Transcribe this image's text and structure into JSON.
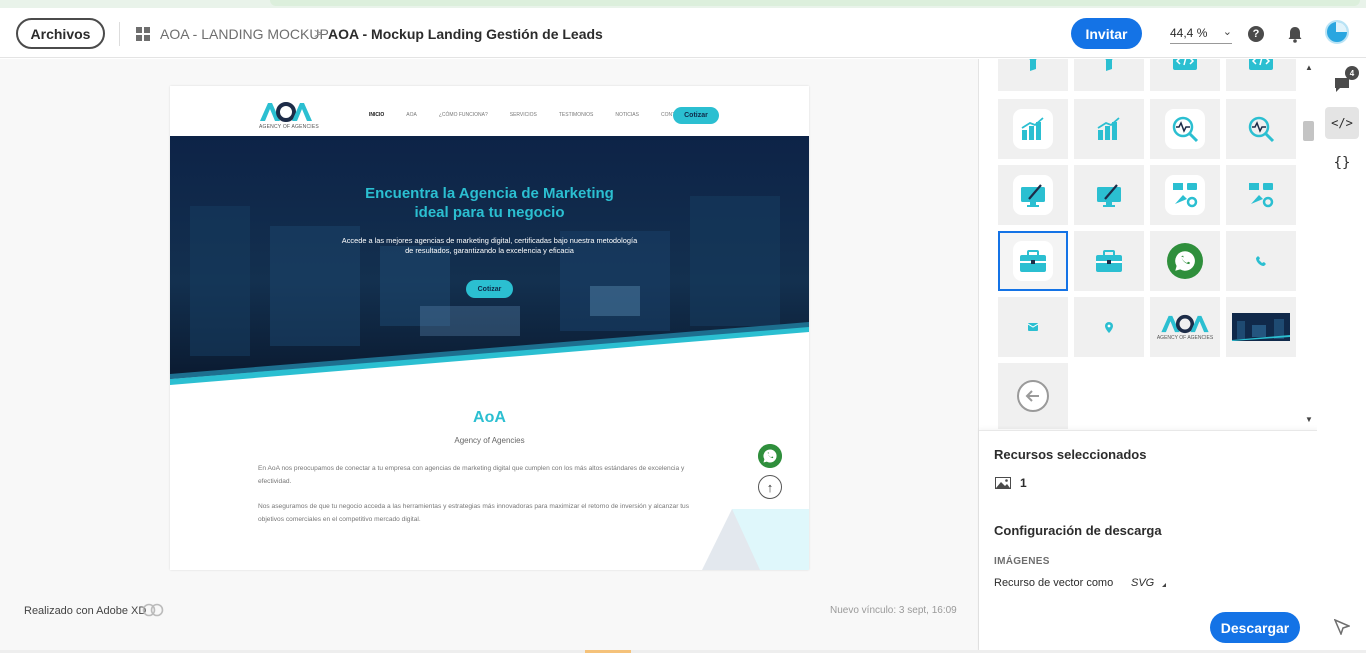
{
  "header": {
    "archivos_label": "Archivos",
    "project_name": "AOA - LANDING MOCKUP",
    "breadcrumb_separator": ">",
    "screen_name": "AOA - Mockup Landing Gestión de Leads",
    "invite_label": "Invitar",
    "zoom": "44,4 %",
    "help_label": "?",
    "accent_color": "#1473e6"
  },
  "artboard": {
    "logo_sub": "AGENCY OF AGENCIES",
    "nav": [
      "INICIO",
      "AOA",
      "¿CÓMO FUNCIONA?",
      "SERVICIOS",
      "TESTIMONIOS",
      "NOTICIAS",
      "CONTACTO"
    ],
    "nav_cta": "Cotizar",
    "hero_title_1": "Encuentra la Agencia de Marketing",
    "hero_title_2": "ideal para tu negocio",
    "hero_subtitle": "Accede a las mejores agencias de marketing digital, certificadas bajo nuestra metodología de resultados, garantizando la excelencia y eficacia",
    "hero_button": "Cotizar",
    "section_title": "AoA",
    "section_subtitle": "Agency of Agencies",
    "paragraph_1": "En AoA nos preocupamos de conectar a tu empresa con agencias de marketing digital que cumplen con los más altos estándares de excelencia y efectividad.",
    "paragraph_2": "Nos aseguramos de que tu negocio acceda a las herramientas y estrategias más innovadoras para maximizar el retorno de inversión y alcanzar tus objetivos comerciales en el competitivo mercado digital.",
    "brand_color": "#2bbfd1"
  },
  "canvas_footer": {
    "made_with": "Realizado con Adobe XD",
    "new_link": "Nuevo vínculo: 3 sept, 16:09"
  },
  "assets_panel": {
    "logo_tile_sub": "AGENCY OF AGENCIES",
    "tiles": [
      "funnel-icon",
      "funnel-icon",
      "code-icon",
      "code-icon",
      "bar-chart-icon",
      "bar-chart-icon",
      "analytics-icon",
      "analytics-icon",
      "monitor-brush-icon",
      "monitor-brush-icon",
      "marketing-icon",
      "marketing-icon",
      "briefcase-icon",
      "briefcase-icon",
      "whatsapp-icon",
      "phone-icon",
      "mail-icon",
      "location-icon",
      "aoa-logo",
      "hero-image",
      "back-arrow-icon"
    ],
    "selected_tile": "briefcase-icon"
  },
  "selection": {
    "title": "Recursos seleccionados",
    "count": "1",
    "download_title": "Configuración de descarga",
    "images_label": "IMÁGENES",
    "vector_label": "Recurso de vector como",
    "vector_value": "SVG",
    "download_button": "Descargar"
  },
  "rail": {
    "comment_count": "4",
    "code_label": "</>",
    "braces_label": "{}"
  }
}
